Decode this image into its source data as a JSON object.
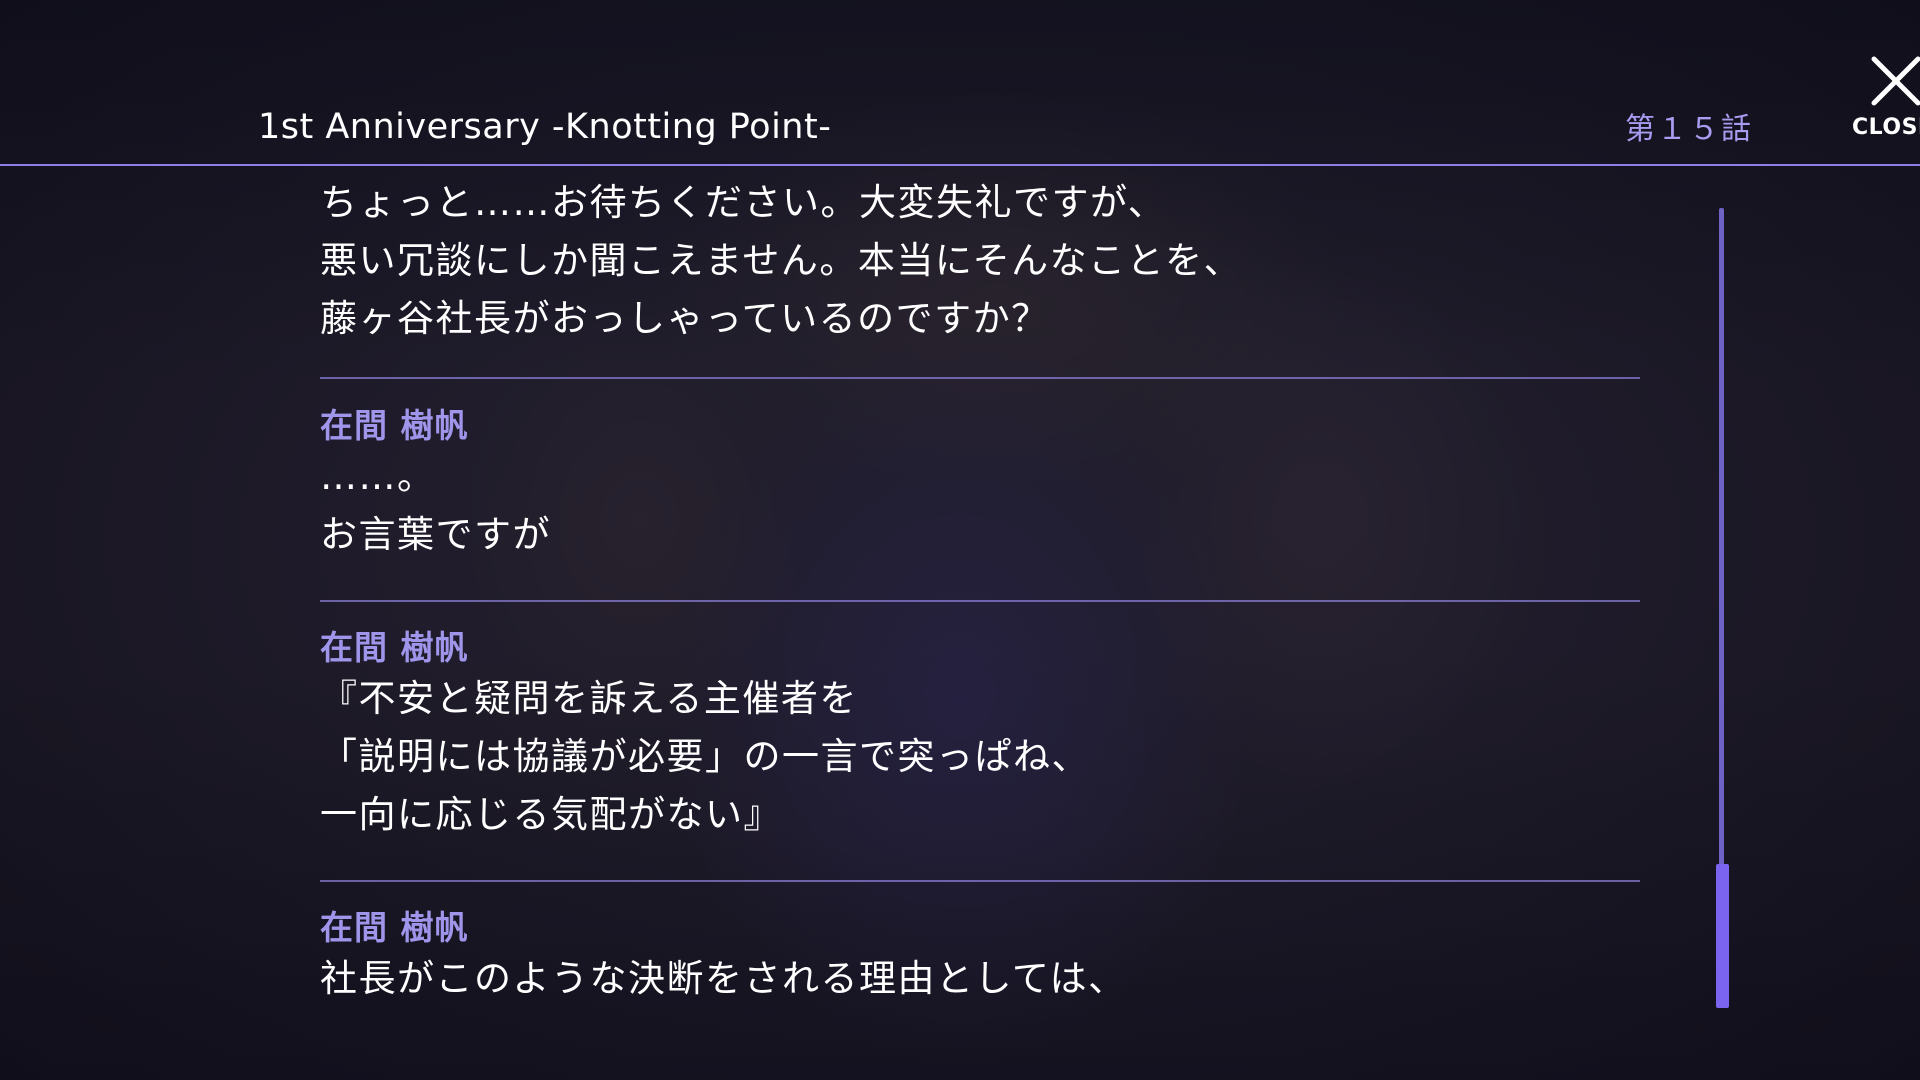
{
  "header": {
    "story_title": "1st Anniversary  -Knotting Point-",
    "chapter": "第１５話",
    "close_label": "CLOSE"
  },
  "log": {
    "entries": [
      {
        "speaker": "",
        "lines": [
          "ちょっと……お待ちください。大変失礼ですが、",
          "悪い冗談にしか聞こえません。本当にそんなことを、",
          "藤ヶ谷社長がおっしゃっているのですか？"
        ]
      },
      {
        "speaker": "在間 樹帆",
        "lines": [
          "……。",
          "お言葉ですが"
        ]
      },
      {
        "speaker": "在間 樹帆",
        "lines": [
          "『不安と疑問を訴える主催者を",
          "「説明には協議が必要」の一言で突っぱね、",
          "一向に応じる気配がない』"
        ]
      },
      {
        "speaker": "在間 樹帆",
        "lines": [
          "社長がこのような決断をされる理由としては、"
        ]
      }
    ]
  },
  "scroll": {
    "position_fraction": 0.82,
    "visible_fraction": 0.18
  },
  "colors": {
    "accent": "#8d7fe6",
    "speaker": "#9f95ea",
    "chapter": "#a79cf0",
    "scroll_thumb": "#7a64f0"
  },
  "icons": {
    "close": "close-icon"
  }
}
